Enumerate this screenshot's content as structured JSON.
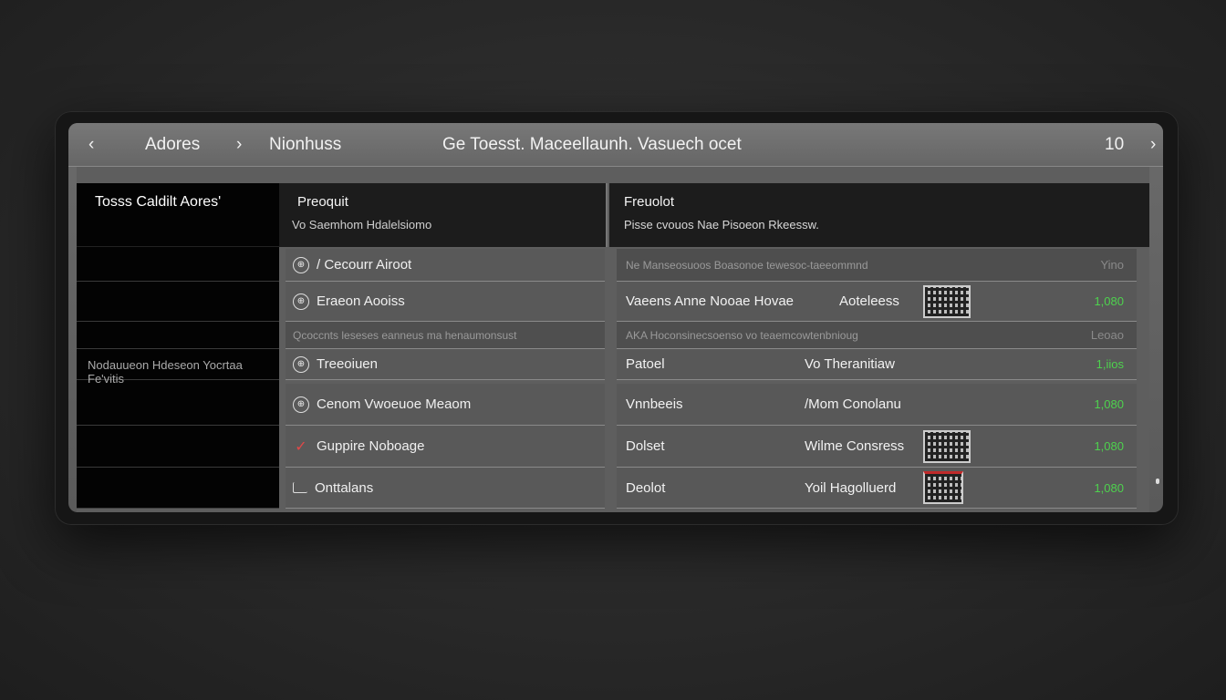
{
  "header": {
    "back_icon": "chevron-left-icon",
    "title_first": "Adores",
    "separator": "›",
    "title_second": "Nionhuss",
    "title_center": "Ge Toesst. Maceellaunh. Vasuech ocet",
    "count": "10",
    "close_icon": "chevron-right-icon"
  },
  "left": {
    "header": "Tosss Caldilt Aores'",
    "row_label": "Nodauueon Hdeseon Yocrtaa Fe'vitis"
  },
  "middle": {
    "header_title": "Preoquit",
    "header_subtitle": "Vo Saemhom Hdalelsiomo",
    "rows": [
      {
        "icon": "globe-icon",
        "label": "/ Cecourr Airoot"
      },
      {
        "icon": "globe-icon",
        "label": "Eraeon Aooiss"
      },
      {
        "icon": "",
        "label": "Qcoccnts leseses eanneus ma henaumonsust"
      },
      {
        "icon": "globe-icon",
        "label": "Treeoiuen"
      },
      {
        "icon": "globe-icon",
        "label": "Cenom Vwoeuoe Meaom"
      },
      {
        "icon": "check-icon",
        "label": "Guppire Noboage"
      },
      {
        "icon": "box-icon",
        "label": "Onttalans"
      }
    ]
  },
  "right": {
    "header_title": "Freuolot",
    "header_subtitle": "Pisse cvouos Nae Pisoeon Rkeessw.",
    "rows": [
      {
        "c1": "Ne Manseosuoos Boasonoe tewesoc-taeeommnd",
        "c2": "",
        "value": "Yino"
      },
      {
        "c1": "Vaeens Anne Nooae Hovae",
        "c2": "Aoteleess",
        "value": "1,080"
      },
      {
        "c1": "AKA Hoconsinecsoenso vo teaemcowtenbnioug",
        "c2": "",
        "value": "Leoao"
      },
      {
        "c1": "Patoel",
        "c2": "Vo Theranitiaw",
        "value": "1,iios"
      },
      {
        "c1": "Vnnbeeis",
        "c2": "/Mom Conolanu",
        "value": "1,080"
      },
      {
        "c1": "Dolset",
        "c2": "Wilme Consress",
        "value": "1,080"
      },
      {
        "c1": "Deolot",
        "c2": "Yoil Hagolluerd",
        "value": "1,080"
      }
    ]
  }
}
